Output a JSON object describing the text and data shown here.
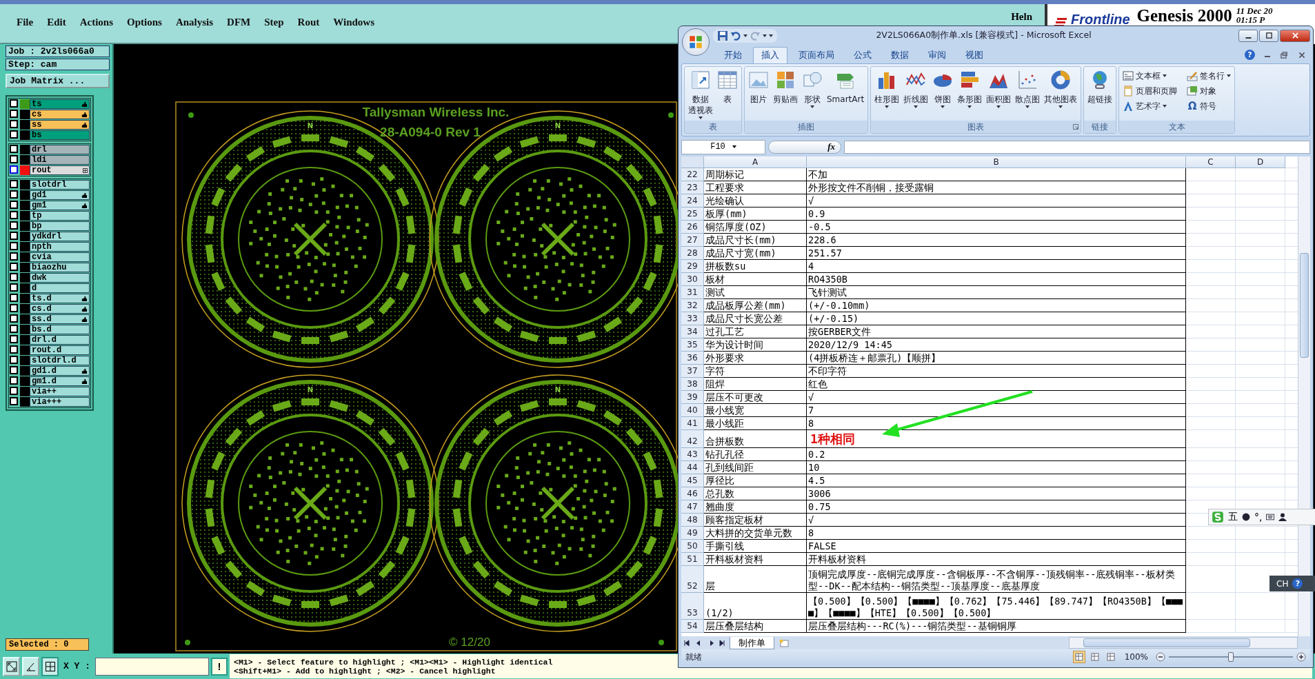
{
  "genesis": {
    "menu": [
      "File",
      "Edit",
      "Actions",
      "Options",
      "Analysis",
      "DFM",
      "Step",
      "Rout",
      "Windows"
    ],
    "help_menu": "Heln",
    "logo": "Frontline",
    "product": "Genesis 2000",
    "date": "11 Dec 20",
    "time": "01:15 P",
    "job": "Job : 2v2ls066a0",
    "step": "Step: cam",
    "job_matrix_button": "Job Matrix ...",
    "layer_groups": [
      {
        "layers": [
          {
            "name": "ts",
            "checked": false,
            "work_layer": false,
            "flagged": true,
            "kind": "signal",
            "color": "#3c9a18"
          },
          {
            "name": "cs",
            "checked": false,
            "work_layer": false,
            "flagged": true,
            "kind": "mask"
          },
          {
            "name": "ss",
            "checked": false,
            "work_layer": false,
            "flagged": true,
            "kind": "mask"
          },
          {
            "name": "bs",
            "checked": false,
            "work_layer": false,
            "flagged": false,
            "kind": "signal"
          }
        ]
      },
      {
        "layers": [
          {
            "name": "drl",
            "checked": false,
            "work_layer": false,
            "flagged": false,
            "kind": "drill"
          },
          {
            "name": "ldi",
            "checked": false,
            "work_layer": false,
            "flagged": false,
            "kind": "drill"
          },
          {
            "name": "rout",
            "checked": false,
            "work_layer": true,
            "flagged": false,
            "kind": "rout",
            "color": "#f01010"
          }
        ]
      },
      {
        "layers": [
          {
            "name": "slotdrl",
            "checked": false,
            "work_layer": false,
            "flagged": false,
            "kind": "misc"
          },
          {
            "name": "gd1",
            "checked": false,
            "work_layer": false,
            "flagged": true,
            "kind": "misc"
          },
          {
            "name": "gm1",
            "checked": false,
            "work_layer": false,
            "flagged": true,
            "kind": "misc"
          },
          {
            "name": "tp",
            "checked": false,
            "work_layer": false,
            "flagged": false,
            "kind": "misc"
          },
          {
            "name": "bp",
            "checked": false,
            "work_layer": false,
            "flagged": false,
            "kind": "misc"
          },
          {
            "name": "ydkdrl",
            "checked": false,
            "work_layer": false,
            "flagged": false,
            "kind": "misc"
          },
          {
            "name": "npth",
            "checked": false,
            "work_layer": false,
            "flagged": false,
            "kind": "misc"
          },
          {
            "name": "cvia",
            "checked": false,
            "work_layer": false,
            "flagged": false,
            "kind": "misc"
          },
          {
            "name": "biaozhu",
            "checked": false,
            "work_layer": false,
            "flagged": false,
            "kind": "misc"
          },
          {
            "name": "dwk",
            "checked": false,
            "work_layer": false,
            "flagged": false,
            "kind": "misc"
          },
          {
            "name": "d",
            "checked": false,
            "work_layer": false,
            "flagged": false,
            "kind": "misc"
          },
          {
            "name": "ts.d",
            "checked": false,
            "work_layer": false,
            "flagged": true,
            "kind": "misc"
          },
          {
            "name": "cs.d",
            "checked": false,
            "work_layer": false,
            "flagged": true,
            "kind": "misc"
          },
          {
            "name": "ss.d",
            "checked": false,
            "work_layer": false,
            "flagged": true,
            "kind": "misc"
          },
          {
            "name": "bs.d",
            "checked": false,
            "work_layer": false,
            "flagged": false,
            "kind": "misc"
          },
          {
            "name": "drl.d",
            "checked": false,
            "work_layer": false,
            "flagged": false,
            "kind": "misc"
          },
          {
            "name": "rout.d",
            "checked": false,
            "work_layer": false,
            "flagged": false,
            "kind": "misc"
          },
          {
            "name": "slotdrl.d",
            "checked": false,
            "work_layer": false,
            "flagged": false,
            "kind": "misc"
          },
          {
            "name": "gd1.d",
            "checked": false,
            "work_layer": false,
            "flagged": true,
            "kind": "misc"
          },
          {
            "name": "gm1.d",
            "checked": false,
            "work_layer": false,
            "flagged": true,
            "kind": "misc"
          },
          {
            "name": "via++",
            "checked": false,
            "work_layer": false,
            "flagged": false,
            "kind": "misc"
          },
          {
            "name": "via+++",
            "checked": false,
            "work_layer": false,
            "flagged": false,
            "kind": "misc"
          }
        ]
      }
    ],
    "selected_count": "Selected : 0",
    "canvas": {
      "title": "Tallysman Wireless Inc.",
      "revision": "28-A094-0 Rev 1",
      "date_code": "© 12/20",
      "boards": [
        {
          "marker": "N"
        },
        {
          "marker": "N"
        },
        {
          "marker": "N"
        },
        {
          "marker": "N"
        }
      ]
    },
    "coordinate_label": "X Y :",
    "alert_button": "!",
    "hints": [
      "<M1> - Select feature to highlight ; <M1><M1> - Highlight identical",
      "<Shift+M1> - Add to highlight ; <M2> - Cancel highlight"
    ]
  },
  "excel": {
    "title": "2V2LS066A0制作单.xls  [兼容模式] - Microsoft Excel",
    "help": "?",
    "tabs": [
      {
        "label": "开始",
        "selected": false
      },
      {
        "label": "插入",
        "selected": true
      },
      {
        "label": "页面布局",
        "selected": false
      },
      {
        "label": "公式",
        "selected": false
      },
      {
        "label": "数据",
        "selected": false
      },
      {
        "label": "审阅",
        "selected": false
      },
      {
        "label": "视图",
        "selected": false
      }
    ],
    "groups": [
      {
        "name": "表",
        "launcher": false,
        "buttons": [
          {
            "kind": "large",
            "lines": [
              "数据",
              "透视表"
            ],
            "dropdown": true
          },
          {
            "kind": "large",
            "lines": [
              "表"
            ],
            "dropdown": false
          }
        ]
      },
      {
        "name": "插图",
        "launcher": false,
        "buttons": [
          {
            "kind": "large",
            "lines": [
              "图片"
            ],
            "dropdown": false
          },
          {
            "kind": "large",
            "lines": [
              "剪贴画"
            ],
            "dropdown": false
          },
          {
            "kind": "large",
            "lines": [
              "形状"
            ],
            "dropdown": true
          },
          {
            "kind": "large",
            "lines": [
              "SmartArt"
            ],
            "dropdown": false
          }
        ]
      },
      {
        "name": "图表",
        "launcher": true,
        "buttons": [
          {
            "kind": "large",
            "lines": [
              "柱形图"
            ],
            "dropdown": true
          },
          {
            "kind": "large",
            "lines": [
              "折线图"
            ],
            "dropdown": true
          },
          {
            "kind": "large",
            "lines": [
              "饼图"
            ],
            "dropdown": true
          },
          {
            "kind": "large",
            "lines": [
              "条形图"
            ],
            "dropdown": true
          },
          {
            "kind": "large",
            "lines": [
              "面积图"
            ],
            "dropdown": true
          },
          {
            "kind": "large",
            "lines": [
              "散点图"
            ],
            "dropdown": true
          },
          {
            "kind": "large",
            "lines": [
              "其他图表"
            ],
            "dropdown": true
          }
        ]
      },
      {
        "name": "链接",
        "launcher": false,
        "buttons": [
          {
            "kind": "large",
            "lines": [
              "超链接"
            ],
            "dropdown": false
          }
        ]
      },
      {
        "name": "文本",
        "launcher": false,
        "buttons": [
          {
            "kind": "small",
            "lines": [
              "文本框"
            ],
            "dropdown": true
          },
          {
            "kind": "small",
            "lines": [
              "页眉和页脚"
            ],
            "dropdown": false
          },
          {
            "kind": "small",
            "lines": [
              "艺术字"
            ],
            "dropdown": true
          },
          {
            "kind": "small",
            "lines": [
              "签名行"
            ],
            "dropdown": true
          },
          {
            "kind": "small",
            "lines": [
              "对象"
            ],
            "dropdown": false
          },
          {
            "kind": "small",
            "lines": [
              "符号"
            ],
            "dropdown": false,
            "glyph": "Ω"
          }
        ]
      }
    ],
    "name_box": "F10",
    "function_label": "fx",
    "columns": [
      "A",
      "B",
      "C",
      "D"
    ],
    "rows": [
      {
        "number": "22",
        "a": "周期标记",
        "b": "不加",
        "kind": "text"
      },
      {
        "number": "23",
        "a": "工程要求",
        "b": "外形按文件不削铜，接受露铜",
        "kind": "text"
      },
      {
        "number": "24",
        "a": "光绘确认",
        "b": "√",
        "kind": "text"
      },
      {
        "number": "25",
        "a": "板厚(mm)",
        "b": "0.9",
        "kind": "text"
      },
      {
        "number": "26",
        "a": "铜箔厚度(OZ)",
        "b": "-0.5",
        "kind": "text"
      },
      {
        "number": "27",
        "a": "成品尺寸长(mm)",
        "b": "228.6",
        "kind": "text"
      },
      {
        "number": "28",
        "a": "成品尺寸宽(mm)",
        "b": "251.57",
        "kind": "text"
      },
      {
        "number": "29",
        "a": "拼板数su",
        "b": "4",
        "kind": "text"
      },
      {
        "number": "30",
        "a": "板材",
        "b": "RO4350B",
        "kind": "text"
      },
      {
        "number": "31",
        "a": "测试",
        "b": "飞针测试",
        "kind": "text"
      },
      {
        "number": "32",
        "a": "成品板厚公差(mm)",
        "b": "(+/-0.10mm)",
        "kind": "text"
      },
      {
        "number": "33",
        "a": "成品尺寸长宽公差",
        "b": "(+/-0.15)",
        "kind": "text"
      },
      {
        "number": "34",
        "a": "过孔工艺",
        "b": "按GERBER文件",
        "kind": "text"
      },
      {
        "number": "35",
        "a": "华为设计时间",
        "b": "2020/12/9 14:45",
        "kind": "text"
      },
      {
        "number": "36",
        "a": "外形要求",
        "b": "(4拼板桥连＋邮票孔)【顺拼】",
        "kind": "text"
      },
      {
        "number": "37",
        "a": "字符",
        "b": "不印字符",
        "kind": "text"
      },
      {
        "number": "38",
        "a": "阻焊",
        "b": "红色",
        "kind": "text"
      },
      {
        "number": "39",
        "a": "层压不可更改",
        "b": "√",
        "kind": "text"
      },
      {
        "number": "40",
        "a": "最小线宽",
        "b": "7",
        "kind": "text"
      },
      {
        "number": "41",
        "a": "最小线距",
        "b": "8",
        "kind": "text"
      },
      {
        "number": "42",
        "a": "合拼板数",
        "b": "1种相同",
        "kind": "emphasis"
      },
      {
        "number": "43",
        "a": "钻孔孔径",
        "b": "0.2",
        "kind": "text"
      },
      {
        "number": "44",
        "a": "孔到线间距",
        "b": "10",
        "kind": "text"
      },
      {
        "number": "45",
        "a": "厚径比",
        "b": "4.5",
        "kind": "text"
      },
      {
        "number": "46",
        "a": "总孔数",
        "b": "3006",
        "kind": "text"
      },
      {
        "number": "47",
        "a": "翘曲度",
        "b": "0.75",
        "kind": "text"
      },
      {
        "number": "48",
        "a": "顾客指定板材",
        "b": "√",
        "kind": "text"
      },
      {
        "number": "49",
        "a": "大料拼的交货单元数",
        "b": "8",
        "kind": "text"
      },
      {
        "number": "50",
        "a": "手撕引线",
        "b": "FALSE",
        "kind": "text"
      },
      {
        "number": "51",
        "a": "开料板材资料",
        "b": "开料板材资料",
        "kind": "text"
      },
      {
        "number": "52",
        "a": "层",
        "b": "顶铜完成厚度--底铜完成厚度--含铜板厚--不含铜厚--顶残铜率--底残铜率--板材类型--DK--配本结构--铜箔类型--顶基厚度--底基厚度",
        "kind": "wrapped"
      },
      {
        "number": "53",
        "a": "(1/2)",
        "b": "【0.500】【0.500】【■■■■】【0.762】【75.446】【89.747】【RO4350B】【■■■■】【■■■■】【HTE】【0.500】【0.500】",
        "kind": "wrapped"
      },
      {
        "number": "54",
        "a": "层压叠层结构",
        "b": "层压叠层结构---RC(%)---铜箔类型--基铜铜厚",
        "kind": "text"
      }
    ],
    "sheet_tabs": [
      {
        "label": "制作单",
        "selected": true
      }
    ],
    "status": "就绪",
    "views": [
      {
        "selected": true
      },
      {
        "selected": false
      },
      {
        "selected": false
      }
    ],
    "zoom": "100%",
    "zoom_slider": {
      "level": 0.5
    }
  },
  "ime": {
    "mode": "五",
    "punctuation": "°,",
    "language": "CH",
    "help": "?"
  }
}
